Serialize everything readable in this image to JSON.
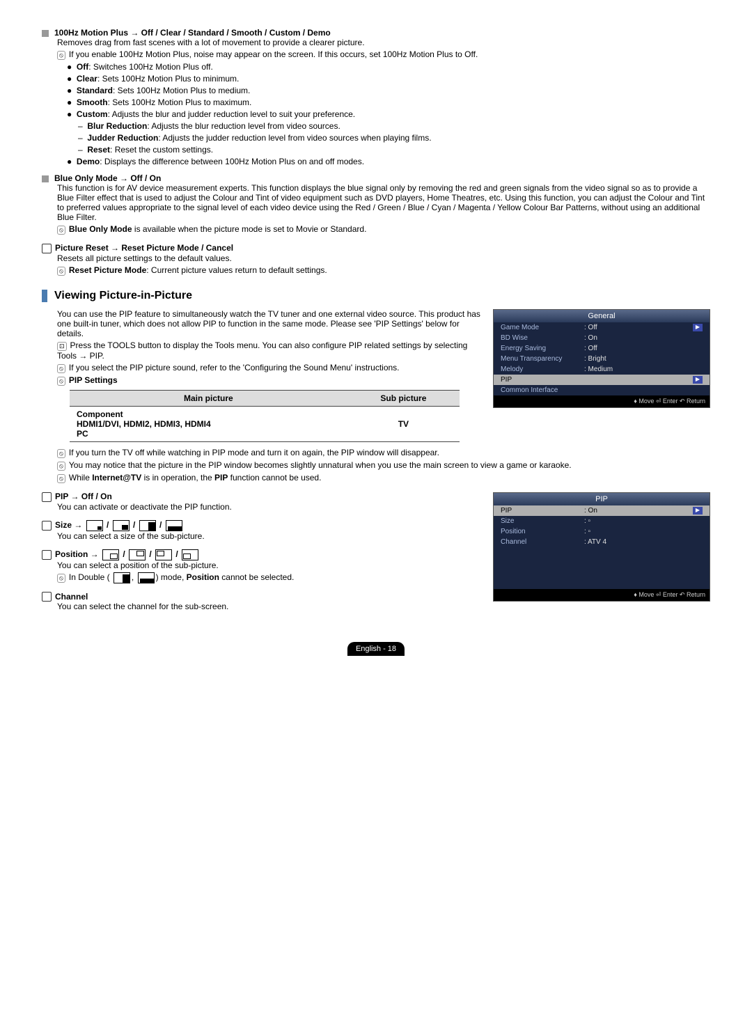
{
  "sec1": {
    "title": "100Hz Motion Plus → Off / Clear / Standard / Smooth / Custom / Demo",
    "desc": "Removes drag from fast scenes with a lot of movement to provide a clearer picture.",
    "note": "If you enable 100Hz Motion Plus, noise may appear on the screen. If this occurs, set 100Hz Motion Plus to Off.",
    "b_off_l": "Off",
    "b_off": ": Switches 100Hz Motion Plus off.",
    "b_clear_l": "Clear",
    "b_clear": ": Sets 100Hz Motion Plus to minimum.",
    "b_std_l": "Standard",
    "b_std": ": Sets 100Hz Motion Plus to medium.",
    "b_smooth_l": "Smooth",
    "b_smooth": ": Sets 100Hz Motion Plus to maximum.",
    "b_custom_l": "Custom",
    "b_custom": ": Adjusts the blur and judder reduction level to suit your preference.",
    "d_blur_l": "Blur Reduction",
    "d_blur": ": Adjusts the blur reduction level from video sources.",
    "d_judder_l": "Judder Reduction",
    "d_judder": ": Adjusts the judder reduction level from video sources when playing films.",
    "d_reset_l": "Reset",
    "d_reset": ": Reset the custom settings.",
    "b_demo_l": "Demo",
    "b_demo": ": Displays the difference between 100Hz Motion Plus on and off modes."
  },
  "sec2": {
    "title": "Blue Only Mode → Off / On",
    "desc": "This function is for AV device measurement experts. This function displays the blue signal only by removing the red and green signals from the video signal so as to provide a Blue Filter effect that is used to adjust the Colour and Tint of video equipment such as DVD players, Home Theatres, etc. Using this function, you can adjust the Colour and Tint to preferred values appropriate to the signal level of each video device using the Red / Green / Blue / Cyan / Magenta / Yellow Colour Bar Patterns, without using an additional Blue Filter.",
    "note_pre": "Blue Only Mode",
    "note": " is available when the picture mode is set to Movie or Standard."
  },
  "sec3": {
    "title": "Picture Reset → Reset Picture Mode / Cancel",
    "desc": "Resets all picture settings to the default values.",
    "note_pre": "Reset Picture Mode",
    "note": ": Current picture values return to default settings."
  },
  "pip_section": {
    "heading": "Viewing Picture-in-Picture",
    "desc": "You can use the PIP feature to simultaneously watch the TV tuner and one external video source. This product has one built-in tuner, which does not allow PIP to function in the same mode. Please see 'PIP Settings' below for details.",
    "tools": "Press the TOOLS button to display the Tools menu. You can also configure PIP related settings by selecting Tools → PIP.",
    "note1": "If you select the PIP picture sound, refer to the 'Configuring the Sound Menu' instructions.",
    "note2": "PIP Settings",
    "tbl_h1": "Main picture",
    "tbl_h2": "Sub picture",
    "tbl_c1a": "Component",
    "tbl_c1b": "HDMI1/DVI, HDMI2, HDMI3, HDMI4",
    "tbl_c1c": "PC",
    "tbl_c2": "TV",
    "note3": "If you turn the TV off while watching in PIP mode and turn it on again, the PIP window will disappear.",
    "note4": "You may notice that the picture in the PIP window becomes slightly unnatural when you use the main screen to view a game or karaoke.",
    "note5_a": "While ",
    "note5_b": "Internet@TV",
    "note5_c": " is in operation, the ",
    "note5_d": "PIP",
    "note5_e": " function cannot be used."
  },
  "pip_off": {
    "title": "PIP → Off / On",
    "desc": "You can activate or deactivate the PIP function."
  },
  "size": {
    "title": "Size → ",
    "desc": "You can select a size of the sub-picture."
  },
  "position": {
    "title": "Position → ",
    "desc": "You can select a position of the sub-picture.",
    "note_a": "In Double (",
    "note_b": ", ",
    "note_c": ") mode, ",
    "note_d": "Position",
    "note_e": " cannot be selected."
  },
  "channel": {
    "title": "Channel",
    "desc": "You can select the channel for the sub-screen."
  },
  "osd1": {
    "title": "General",
    "rows": [
      {
        "label": "Game Mode",
        "val": ": Off",
        "arrow": true
      },
      {
        "label": "BD Wise",
        "val": ": On"
      },
      {
        "label": "Energy Saving",
        "val": ": Off"
      },
      {
        "label": "Menu Transparency",
        "val": ": Bright"
      },
      {
        "label": "Melody",
        "val": ": Medium"
      },
      {
        "label": "PIP",
        "val": "",
        "hl": true,
        "arrow": true
      },
      {
        "label": "Common Interface",
        "val": ""
      }
    ],
    "footer": "♦ Move    ⏎ Enter    ↶ Return"
  },
  "osd2": {
    "title": "PIP",
    "rows": [
      {
        "label": "PIP",
        "val": ": On",
        "hl": true,
        "arrow": true
      },
      {
        "label": "Size",
        "val": ": ▫"
      },
      {
        "label": "Position",
        "val": ": ▫"
      },
      {
        "label": "Channel",
        "val": ": ATV 4"
      }
    ],
    "footer": "♦ Move    ⏎ Enter    ↶ Return"
  },
  "footer": "English - 18"
}
